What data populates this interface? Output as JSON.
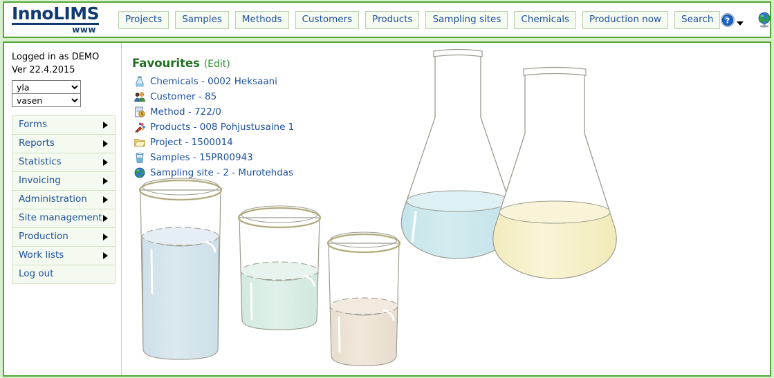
{
  "header": {
    "logo_main": "InnoLIMS",
    "logo_sub": "www",
    "nav": [
      {
        "label": "Projects",
        "name": "nav-projects"
      },
      {
        "label": "Samples",
        "name": "nav-samples"
      },
      {
        "label": "Methods",
        "name": "nav-methods"
      },
      {
        "label": "Customers",
        "name": "nav-customers"
      },
      {
        "label": "Products",
        "name": "nav-products"
      },
      {
        "label": "Sampling sites",
        "name": "nav-sampling-sites"
      },
      {
        "label": "Chemicals",
        "name": "nav-chemicals"
      },
      {
        "label": "Production now",
        "name": "nav-production-now"
      },
      {
        "label": "Search",
        "name": "nav-search"
      }
    ],
    "icons": [
      {
        "name": "help-icon",
        "glyph": "?"
      },
      {
        "name": "globe-icon",
        "glyph": "globe"
      }
    ]
  },
  "sidebar": {
    "logged_in_text": "Logged in as DEMO",
    "version_text": "Ver 22.4.2015",
    "selects": [
      {
        "name": "top-layout-select",
        "value": "yla",
        "options": [
          "yla"
        ]
      },
      {
        "name": "left-layout-select",
        "value": "vasen",
        "options": [
          "vasen"
        ]
      }
    ],
    "menu": [
      {
        "label": "Forms",
        "name": "sidebar-item-forms",
        "arrow": true
      },
      {
        "label": "Reports",
        "name": "sidebar-item-reports",
        "arrow": true
      },
      {
        "label": "Statistics",
        "name": "sidebar-item-statistics",
        "arrow": true
      },
      {
        "label": "Invoicing",
        "name": "sidebar-item-invoicing",
        "arrow": true
      },
      {
        "label": "Administration",
        "name": "sidebar-item-administration",
        "arrow": true
      },
      {
        "label": "Site management",
        "name": "sidebar-item-site-management",
        "arrow": true
      },
      {
        "label": "Production",
        "name": "sidebar-item-production",
        "arrow": true
      },
      {
        "label": "Work lists",
        "name": "sidebar-item-work-lists",
        "arrow": true
      },
      {
        "label": "Log out",
        "name": "sidebar-item-log-out",
        "arrow": false
      }
    ]
  },
  "main": {
    "favourites_title": "Favourites",
    "favourites_edit": "(Edit)",
    "favourites": [
      {
        "label": "Chemicals - 0002 Heksaani",
        "icon": "chemical-bottle-icon",
        "name": "favourite-chemicals"
      },
      {
        "label": "Customer - 85",
        "icon": "customers-icon",
        "name": "favourite-customer"
      },
      {
        "label": "Method - 722/0",
        "icon": "method-clipboard-icon",
        "name": "favourite-method"
      },
      {
        "label": "Products - 008 Pohjustusaine 1",
        "icon": "products-palette-icon",
        "name": "favourite-products"
      },
      {
        "label": "Project - 1500014",
        "icon": "project-folder-icon",
        "name": "favourite-project"
      },
      {
        "label": "Samples - 15PR00943",
        "icon": "sample-beaker-icon",
        "name": "favourite-samples"
      },
      {
        "label": "Sampling site - 2 - Murotehdas",
        "icon": "sampling-site-globe-icon",
        "name": "favourite-sampling-site"
      }
    ],
    "artwork": {
      "name": "laboratory-glassware-illustration",
      "vessels": [
        {
          "name": "beaker-blue",
          "liquid_color": "#d5e4ec"
        },
        {
          "name": "beaker-mint",
          "liquid_color": "#d7ece1"
        },
        {
          "name": "beaker-beige",
          "liquid_color": "#ece2d4"
        },
        {
          "name": "flask-cyan",
          "liquid_color": "#cbe7ec"
        },
        {
          "name": "flask-yellow",
          "liquid_color": "#f4eec4"
        }
      ]
    }
  },
  "colors": {
    "page_background": "#d9efd0",
    "panel_border": "#4fa832",
    "link_blue": "#1c4f9c",
    "logo_navy": "#103a72",
    "heading_green": "#1f6f1f"
  }
}
